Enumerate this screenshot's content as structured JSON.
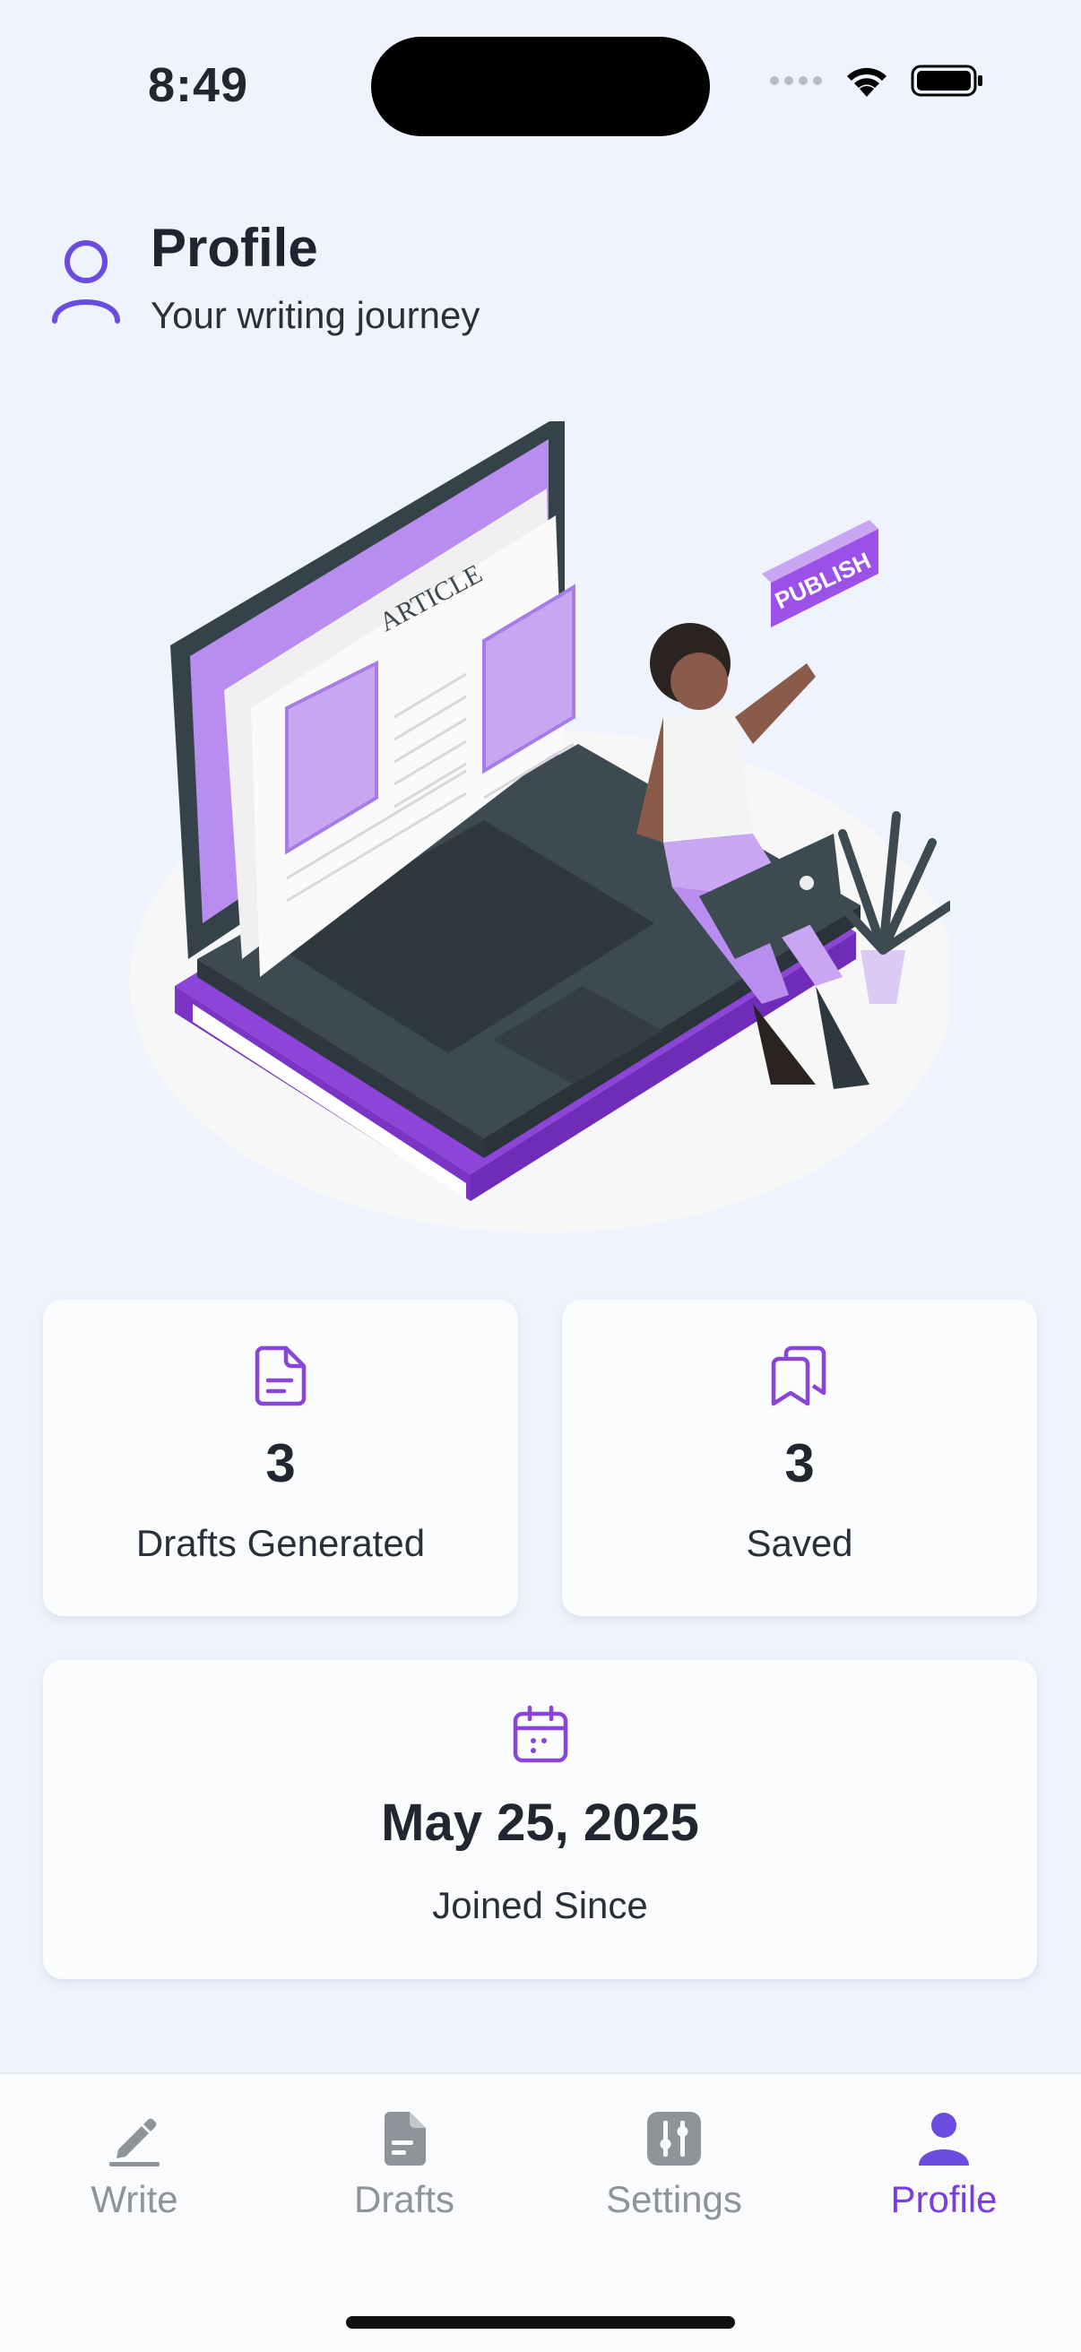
{
  "status_bar": {
    "time": "8:49"
  },
  "header": {
    "title": "Profile",
    "subtitle": "Your writing journey",
    "icon": "user-outline-icon"
  },
  "illustration": {
    "article_label": "ARTICLE",
    "publish_label": "PUBLISH"
  },
  "stats": {
    "drafts": {
      "value": "3",
      "label": "Drafts Generated",
      "icon": "document-icon"
    },
    "saved": {
      "value": "3",
      "label": "Saved",
      "icon": "bookmarks-icon"
    },
    "joined": {
      "value": "May 25, 2025",
      "label": "Joined Since",
      "icon": "calendar-icon"
    }
  },
  "nav": {
    "items": [
      {
        "label": "Write",
        "icon": "pencil-icon",
        "active": false
      },
      {
        "label": "Drafts",
        "icon": "drafts-icon",
        "active": false
      },
      {
        "label": "Settings",
        "icon": "sliders-icon",
        "active": false
      },
      {
        "label": "Profile",
        "icon": "person-icon",
        "active": true
      }
    ]
  },
  "colors": {
    "accent": "#7a3ce0",
    "background": "#eef3fd",
    "card": "#fbfcfe",
    "inactive": "#8f939a"
  }
}
